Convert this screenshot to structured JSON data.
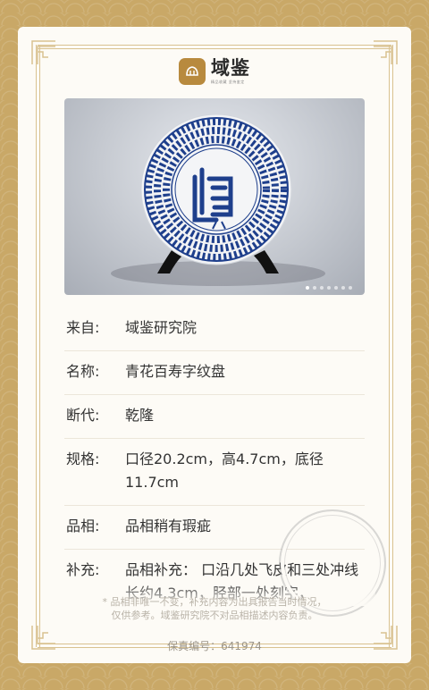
{
  "logo": {
    "name": "域鉴",
    "slogan": "精品收藏 坚持鉴定"
  },
  "photo": {
    "alt": "青花百寿字纹盘",
    "dots_total": 7,
    "active_dot": 0
  },
  "details": [
    {
      "label": "来自:",
      "value": "域鉴研究院"
    },
    {
      "label": "名称:",
      "value": "青花百寿字纹盘"
    },
    {
      "label": "断代:",
      "value": "乾隆"
    },
    {
      "label": "规格:",
      "value": "口径20.2cm，高4.7cm，底径11.7cm"
    },
    {
      "label": "品相:",
      "value": "品相稍有瑕疵"
    },
    {
      "label": "补充:",
      "value": "品相补充：  口沿几处飞皮和三处冲线长约4.3cm，胫部一处刻字，"
    }
  ],
  "disclaimer": {
    "line1": "* 品相非唯一不变，补充内容为出具报告当时情况，",
    "line2": "仅供参考。域鉴研究院不对品相描述内容负责。"
  },
  "serial": "保真编号：641974",
  "colors": {
    "background": "#c9a867",
    "card": "#fdfbf6",
    "frame": "#d9c290",
    "logo_mark": "#b88a3e",
    "porcelain_blue": "#1e3f8c"
  }
}
